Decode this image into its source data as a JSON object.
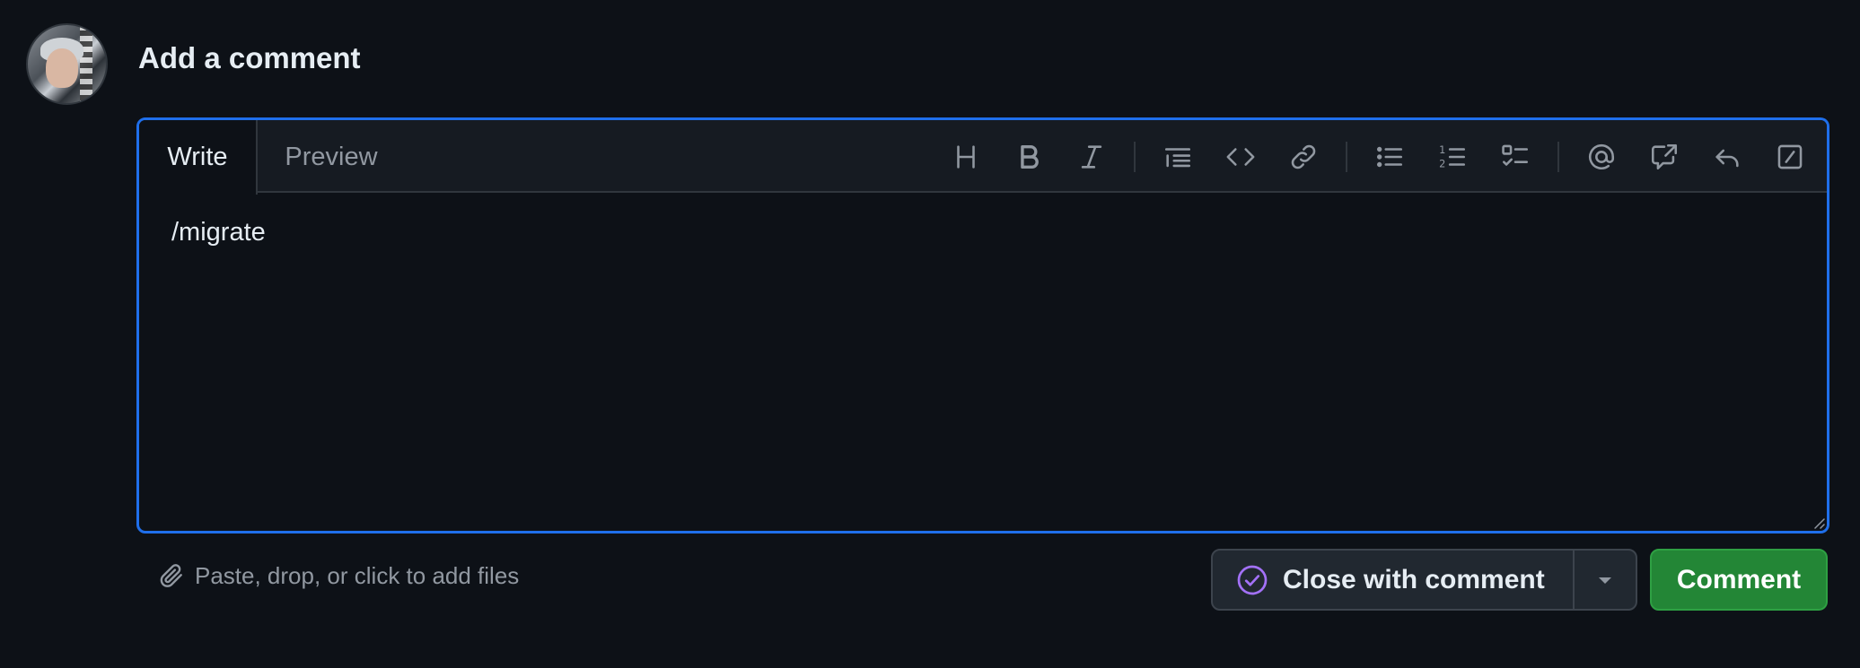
{
  "comment": {
    "title": "Add a comment",
    "tabs": [
      {
        "label": "Write",
        "active": true
      },
      {
        "label": "Preview",
        "active": false
      }
    ],
    "toolbar": [
      {
        "icon": "heading-icon"
      },
      {
        "icon": "bold-icon"
      },
      {
        "icon": "italic-icon"
      },
      {
        "icon": "quote-icon"
      },
      {
        "icon": "code-icon"
      },
      {
        "icon": "link-icon"
      },
      {
        "icon": "unordered-list-icon"
      },
      {
        "icon": "ordered-list-icon"
      },
      {
        "icon": "task-list-icon"
      },
      {
        "icon": "mention-icon"
      },
      {
        "icon": "cross-reference-icon"
      },
      {
        "icon": "saved-reply-icon"
      },
      {
        "icon": "slash-commands-icon"
      }
    ],
    "body_value": "/migrate",
    "attach_label": "Paste, drop, or click to add files",
    "close_button_label": "Close with comment",
    "comment_button_label": "Comment"
  },
  "colors": {
    "background": "#0d1117",
    "focus_border": "#1f6feb",
    "primary_button": "#238636",
    "close_icon": "#a371f7"
  }
}
